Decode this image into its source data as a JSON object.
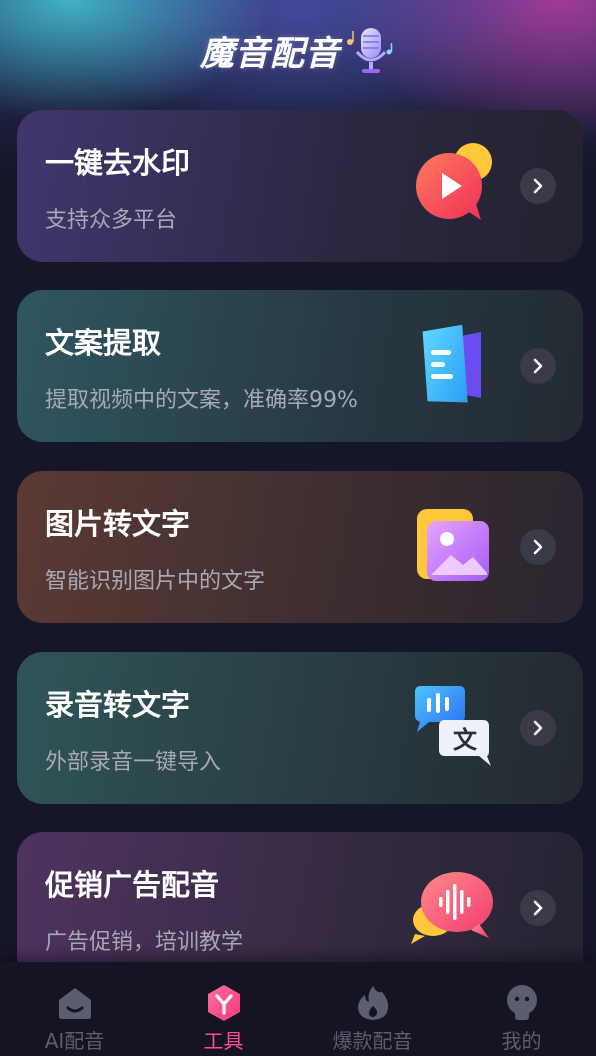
{
  "app": {
    "title": "魔音配音",
    "mic_icon": "microphone-icon"
  },
  "cards": [
    {
      "title": "一键去水印",
      "subtitle": "支持众多平台",
      "icon": "play-bubble-icon"
    },
    {
      "title": "文案提取",
      "subtitle": "提取视频中的文案，准确率99%",
      "icon": "document-icon"
    },
    {
      "title": "图片转文字",
      "subtitle": "智能识别图片中的文字",
      "icon": "image-icon"
    },
    {
      "title": "录音转文字",
      "subtitle": "外部录音一键导入",
      "icon": "speech-to-text-icon"
    },
    {
      "title": "促销广告配音",
      "subtitle": "广告促销，培训教学",
      "icon": "sound-wave-bubble-icon"
    }
  ],
  "tabbar": {
    "items": [
      {
        "label": "AI配音",
        "icon": "home-icon",
        "active": false
      },
      {
        "label": "工具",
        "icon": "tools-icon",
        "active": true
      },
      {
        "label": "爆款配音",
        "icon": "flame-icon",
        "active": false
      },
      {
        "label": "我的",
        "icon": "profile-icon",
        "active": false
      }
    ]
  },
  "colors": {
    "background": "#16162a",
    "active_tab": "#ff4f8a",
    "inactive_tab": "#5c5d6e",
    "subtitle": "#a7a9b6"
  }
}
